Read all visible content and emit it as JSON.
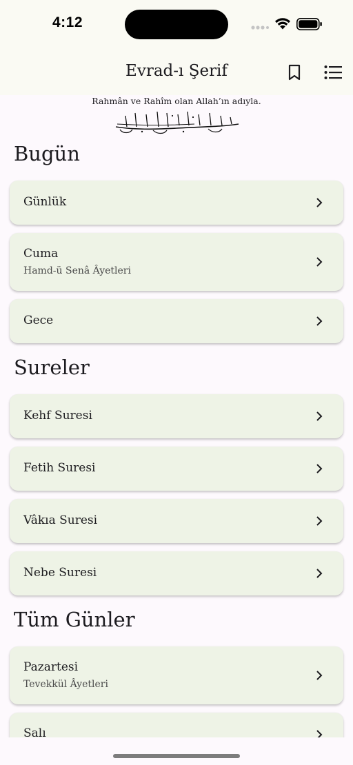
{
  "status_bar": {
    "time": "4:12"
  },
  "app_bar": {
    "title": "Evrad-ı Şerif",
    "bookmark_icon": "bookmark-icon",
    "menu_icon": "list-icon"
  },
  "basmala": {
    "caption": "Rahmân ve Rahîm olan Allah’ın adıyla.",
    "calligraphy_text": "بسم الله الرحمن الرحيم"
  },
  "sections": [
    {
      "title": "Bugün",
      "items": [
        {
          "title": "Günlük",
          "subtitle": ""
        },
        {
          "title": "Cuma",
          "subtitle": "Hamd-ü Senâ Âyetleri"
        },
        {
          "title": "Gece",
          "subtitle": ""
        }
      ]
    },
    {
      "title": "Sureler",
      "items": [
        {
          "title": "Kehf Suresi",
          "subtitle": ""
        },
        {
          "title": "Fetih Suresi",
          "subtitle": ""
        },
        {
          "title": "Vâkıa Suresi",
          "subtitle": ""
        },
        {
          "title": "Nebe Suresi",
          "subtitle": ""
        }
      ]
    },
    {
      "title": "Tüm Günler",
      "items": [
        {
          "title": "Pazartesi",
          "subtitle": "Tevekkül Âyetleri"
        },
        {
          "title": "Salı",
          "subtitle": ""
        }
      ]
    }
  ],
  "colors": {
    "background": "#fdf9fd",
    "app_bar": "#fafaf3",
    "card": "#eef3e6",
    "text": "#1c1b1f"
  }
}
